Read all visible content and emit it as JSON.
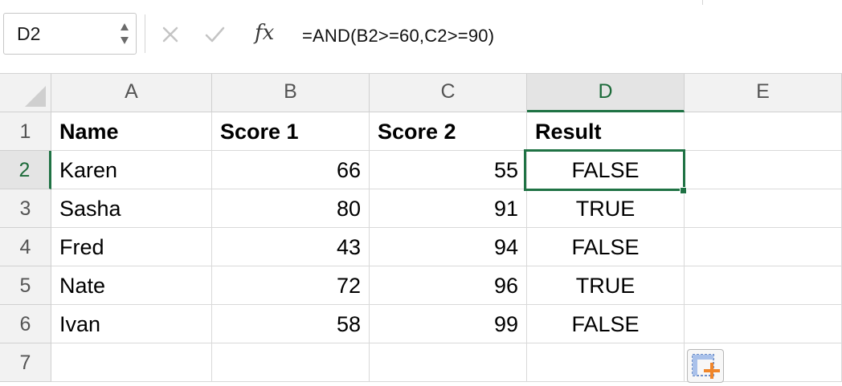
{
  "formula_bar": {
    "name_box": "D2",
    "fx_label": "fx",
    "formula": "=AND(B2>=60,C2>=90)",
    "cancel_icon": "cancel-icon",
    "enter_icon": "checkmark-icon"
  },
  "columns": [
    "A",
    "B",
    "C",
    "D",
    "E"
  ],
  "active_column": "D",
  "rows": [
    "1",
    "2",
    "3",
    "4",
    "5",
    "6",
    "7"
  ],
  "active_row": "2",
  "table": {
    "headers": [
      "Name",
      "Score 1",
      "Score 2",
      "Result"
    ],
    "data": [
      {
        "name": "Karen",
        "score1": "66",
        "score2": "55",
        "result": "FALSE"
      },
      {
        "name": "Sasha",
        "score1": "80",
        "score2": "91",
        "result": "TRUE"
      },
      {
        "name": "Fred",
        "score1": "43",
        "score2": "94",
        "result": "FALSE"
      },
      {
        "name": "Nate",
        "score1": "72",
        "score2": "96",
        "result": "TRUE"
      },
      {
        "name": "Ivan",
        "score1": "58",
        "score2": "99",
        "result": "FALSE"
      }
    ]
  },
  "selected_cell": "D2",
  "quick_analysis_icon": "quick-analysis-icon",
  "colors": {
    "accent": "#1f7244",
    "gridline": "#d9d9d9",
    "header_bg": "#f2f2f2"
  }
}
